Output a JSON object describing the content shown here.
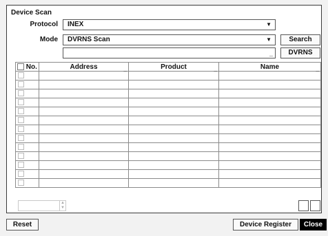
{
  "dialog": {
    "title": "Device Scan"
  },
  "protocol": {
    "label": "Protocol",
    "value": "INEX"
  },
  "mode": {
    "label": "Mode",
    "value": "DVRNS Scan"
  },
  "dvrns_input": {
    "value": ""
  },
  "buttons": {
    "search": "Search",
    "dvrns": "DVRNS",
    "reset": "Reset",
    "device_register": "Device Register",
    "close": "Close"
  },
  "table": {
    "columns": [
      "No.",
      "Address",
      "Product",
      "Name"
    ],
    "row_count": 13
  },
  "icons": {
    "dropdown": "dropdown-arrow-icon",
    "sort": "sort-caret-icon"
  },
  "colors": {
    "close_bg": "#000000",
    "panel_border": "#3a3a3a"
  }
}
